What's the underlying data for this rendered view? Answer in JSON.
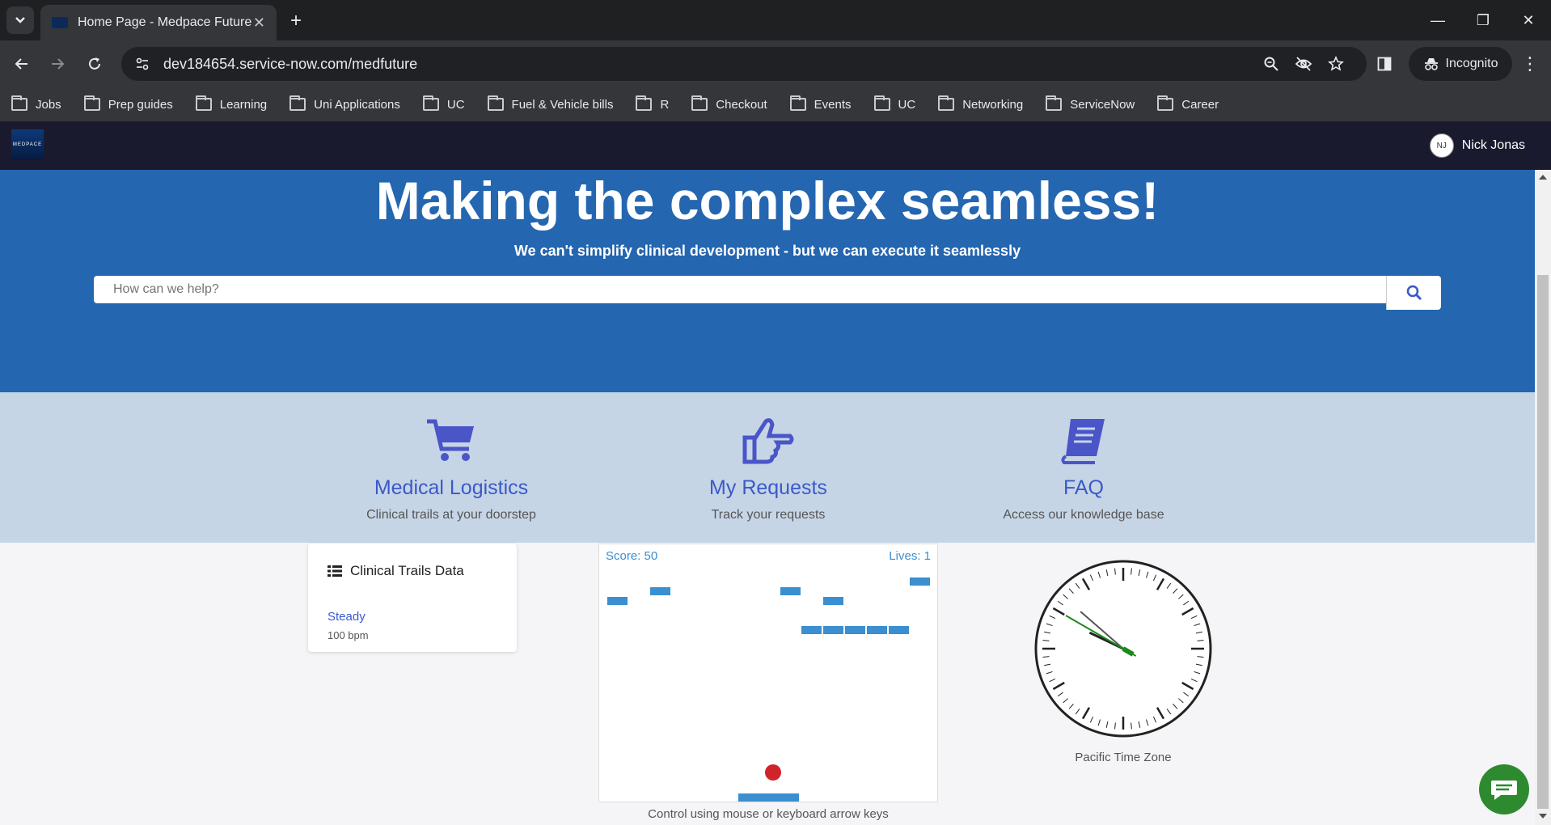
{
  "browser": {
    "tab_title": "Home Page - Medpace Future",
    "tab_close": "✕",
    "new_tab": "+",
    "url": "dev184654.service-now.com/medfuture",
    "incognito_label": "Incognito",
    "window_controls": {
      "minimize": "—",
      "restore": "❐",
      "close": "✕"
    },
    "bookmarks": [
      "Jobs",
      "Prep guides",
      "Learning",
      "Uni Applications",
      "UC",
      "Fuel & Vehicle bills",
      "R",
      "Checkout",
      "Events",
      "UC",
      "Networking",
      "ServiceNow",
      "Career"
    ]
  },
  "header": {
    "logo_text": "MEDPACE",
    "user_initials": "NJ",
    "user_name": "Nick Jonas"
  },
  "hero": {
    "title": "Making the complex seamless!",
    "subtitle": "We can't simplify clinical development - but we can execute it seamlessly",
    "search_placeholder": "How can we help?"
  },
  "quick_links": [
    {
      "icon": "shopping-cart-icon",
      "title": "Medical Logistics",
      "desc": "Clinical trails at your doorstep"
    },
    {
      "icon": "thumbs-up-icon",
      "title": "My Requests",
      "desc": "Track your requests"
    },
    {
      "icon": "book-icon",
      "title": "FAQ",
      "desc": "Access our knowledge base"
    }
  ],
  "data_card": {
    "title": "Clinical Trails Data",
    "status": "Steady",
    "bpm": "100 bpm"
  },
  "game": {
    "score_text": "Score: 50",
    "lives_text": "Lives: 1",
    "hint": "Control using mouse or keyboard arrow keys"
  },
  "clock": {
    "label": "Pacific Time Zone",
    "hour": 9,
    "minute": 51,
    "second": 50
  },
  "colors": {
    "accent": "#3a59c9",
    "hero_bg": "#2466b0",
    "band_bg": "#c6d5e6",
    "brick": "#3a8fd0",
    "ball": "#d0242b",
    "chat": "#2e8a2e"
  }
}
